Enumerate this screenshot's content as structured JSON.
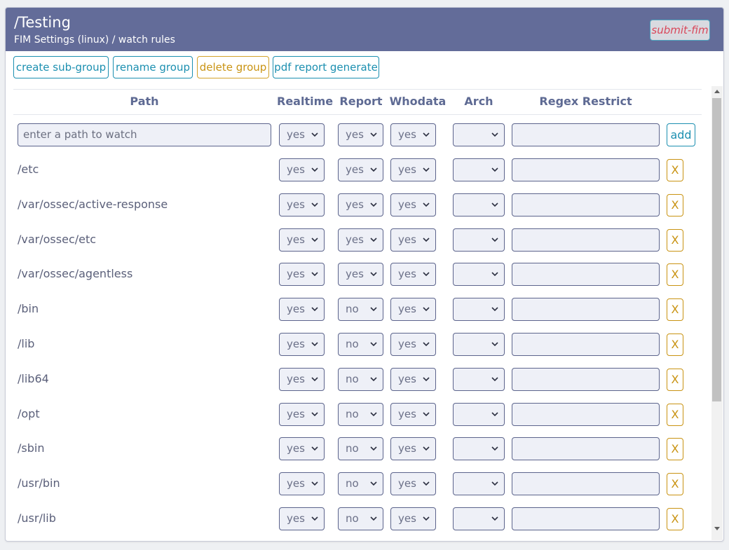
{
  "header": {
    "title": "/Testing",
    "subtitle": "FIM Settings (linux) / watch rules",
    "submit_label": "submit-fim"
  },
  "toolbar": {
    "create_label": "create sub-group",
    "rename_label": "rename group",
    "delete_label": "delete group",
    "pdf_label": "pdf report generate"
  },
  "columns": {
    "path": "Path",
    "realtime": "Realtime",
    "report": "Report",
    "whodata": "Whodata",
    "arch": "Arch",
    "regex": "Regex Restrict"
  },
  "new_rule": {
    "placeholder": "enter a path to watch",
    "realtime": "yes",
    "report": "yes",
    "whodata": "yes",
    "arch": "",
    "add_label": "add"
  },
  "rows": [
    {
      "path": "/etc",
      "realtime": "yes",
      "report": "yes",
      "whodata": "yes",
      "arch": ""
    },
    {
      "path": "/var/ossec/active-response",
      "realtime": "yes",
      "report": "yes",
      "whodata": "yes",
      "arch": ""
    },
    {
      "path": "/var/ossec/etc",
      "realtime": "yes",
      "report": "yes",
      "whodata": "yes",
      "arch": ""
    },
    {
      "path": "/var/ossec/agentless",
      "realtime": "yes",
      "report": "yes",
      "whodata": "yes",
      "arch": ""
    },
    {
      "path": "/bin",
      "realtime": "yes",
      "report": "no",
      "whodata": "yes",
      "arch": ""
    },
    {
      "path": "/lib",
      "realtime": "yes",
      "report": "no",
      "whodata": "yes",
      "arch": ""
    },
    {
      "path": "/lib64",
      "realtime": "yes",
      "report": "no",
      "whodata": "yes",
      "arch": ""
    },
    {
      "path": "/opt",
      "realtime": "yes",
      "report": "no",
      "whodata": "yes",
      "arch": ""
    },
    {
      "path": "/sbin",
      "realtime": "yes",
      "report": "no",
      "whodata": "yes",
      "arch": ""
    },
    {
      "path": "/usr/bin",
      "realtime": "yes",
      "report": "no",
      "whodata": "yes",
      "arch": ""
    },
    {
      "path": "/usr/lib",
      "realtime": "yes",
      "report": "no",
      "whodata": "yes",
      "arch": ""
    }
  ],
  "delete_label": "X",
  "icons": {
    "select_chevron": "chevron-down-icon",
    "scroll_up": "arrow-up-icon",
    "scroll_down": "arrow-down-icon"
  },
  "colors": {
    "header_bg": "#636c99",
    "primary": "#1b8fb0",
    "warning": "#c99312",
    "danger_text": "#d9475a"
  }
}
